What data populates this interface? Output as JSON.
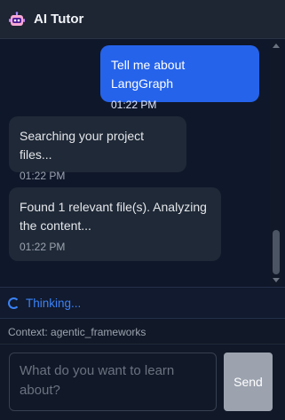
{
  "header": {
    "icon": "robot-icon",
    "title": "AI Tutor"
  },
  "messages": [
    {
      "role": "user",
      "text": "Tell me about LangGraph",
      "time": "01:22 PM"
    },
    {
      "role": "ai",
      "text": "Searching your project files...",
      "time": "01:22 PM"
    },
    {
      "role": "ai",
      "text": "Found 1 relevant file(s). Analyzing the content...",
      "time": "01:22 PM"
    }
  ],
  "status": {
    "icon": "spinner-icon",
    "label": "Thinking..."
  },
  "context": {
    "label": "Context: agentic_frameworks"
  },
  "composer": {
    "placeholder": "What do you want to learn about?",
    "value": "",
    "send_label": "Send"
  },
  "colors": {
    "accent": "#2563eb",
    "background": "#0f172a",
    "ai_bubble": "#1f2937",
    "thinking": "#3b82f6",
    "send_disabled": "#9ca3af"
  }
}
